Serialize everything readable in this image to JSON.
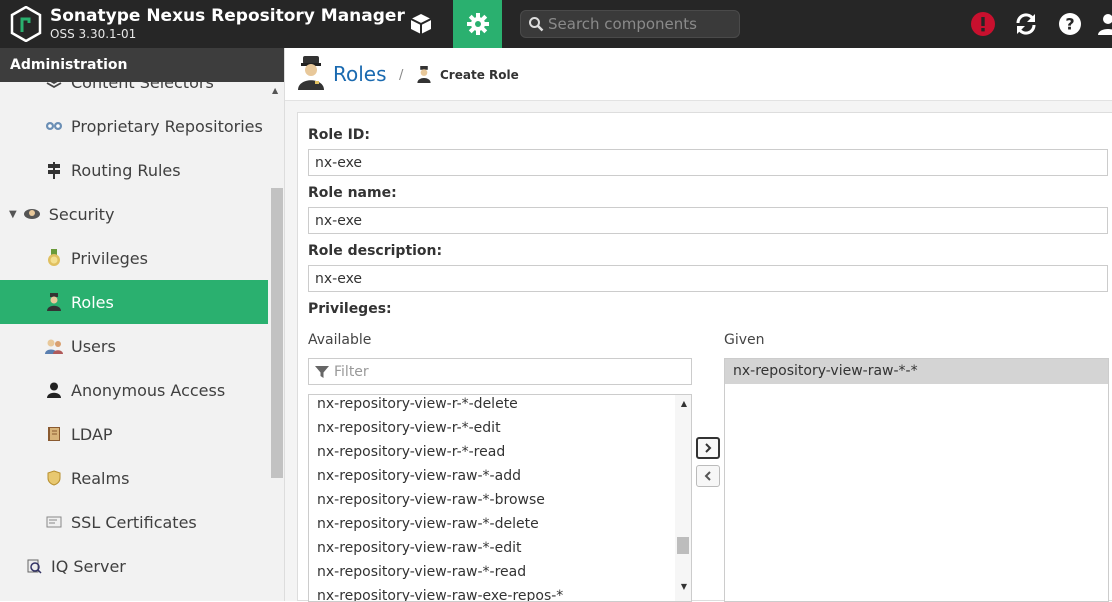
{
  "app": {
    "title": "Sonatype Nexus Repository Manager",
    "version": "OSS 3.30.1-01"
  },
  "topbar": {
    "search_placeholder": "Search components"
  },
  "colors": {
    "accent": "#2ab06f",
    "topbar": "#262626",
    "link": "#1a6ab0",
    "alert": "#c8102e"
  },
  "sidebar": {
    "header": "Administration",
    "items": [
      {
        "label": "Content Selectors",
        "icon": "layers-icon"
      },
      {
        "label": "Proprietary Repositories",
        "icon": "proprietary-icon"
      },
      {
        "label": "Routing Rules",
        "icon": "signpost-icon"
      },
      {
        "label": "Security",
        "icon": "security-icon"
      },
      {
        "label": "Privileges",
        "icon": "medal-icon"
      },
      {
        "label": "Roles",
        "icon": "role-icon"
      },
      {
        "label": "Users",
        "icon": "users-icon"
      },
      {
        "label": "Anonymous Access",
        "icon": "user-icon"
      },
      {
        "label": "LDAP",
        "icon": "book-icon"
      },
      {
        "label": "Realms",
        "icon": "shield-icon"
      },
      {
        "label": "SSL Certificates",
        "icon": "certificate-icon"
      },
      {
        "label": "IQ Server",
        "icon": "iq-server-icon"
      }
    ]
  },
  "breadcrumb": {
    "title": "Roles",
    "separator": "/",
    "current": "Create Role"
  },
  "form": {
    "role_id_label": "Role ID:",
    "role_id_value": "nx-exe",
    "role_name_label": "Role name:",
    "role_name_value": "nx-exe",
    "role_desc_label": "Role description:",
    "role_desc_value": "nx-exe",
    "privileges_label": "Privileges:",
    "available_label": "Available",
    "given_label": "Given",
    "filter_placeholder": "Filter",
    "available_items": [
      "nx-repository-view-r-*-delete",
      "nx-repository-view-r-*-edit",
      "nx-repository-view-r-*-read",
      "nx-repository-view-raw-*-add",
      "nx-repository-view-raw-*-browse",
      "nx-repository-view-raw-*-delete",
      "nx-repository-view-raw-*-edit",
      "nx-repository-view-raw-*-read",
      "nx-repository-view-raw-exe-repos-*"
    ],
    "given_items": [
      "nx-repository-view-raw-*-*"
    ]
  }
}
